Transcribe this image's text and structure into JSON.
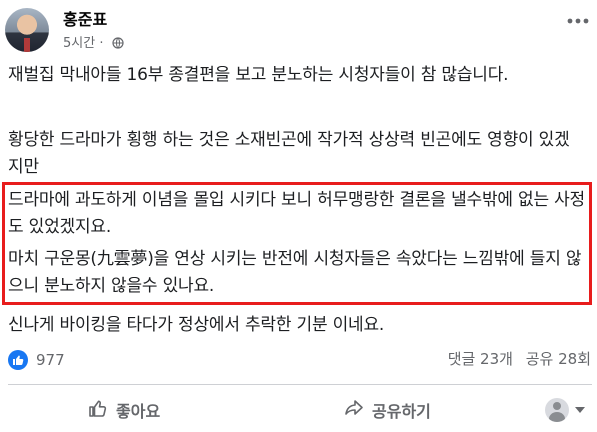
{
  "post": {
    "author": "홍준표",
    "time": "5시간",
    "separator": "·",
    "paragraphs": [
      "재벌집 막내아들 16부 종결편을 보고 분노하는 시청자들이 참 많습니다.",
      "황당한 드라마가 횡행 하는 것은 소재빈곤에 작가적 상상력 빈곤에도 영향이 있겠지만",
      "드라마에 과도하게 이념을 몰입 시키다 보니 허무맹랑한 결론을 낼수밖에 없는 사정도 있었겠지요.",
      "마치 구운몽(九雲夢)을 연상 시키는 반전에 시청자들은 속았다는 느낌밖에 들지 않으니 분노하지 않을수 있나요.",
      "신나게 바이킹을 타다가 정상에서 추락한 기분 이네요."
    ]
  },
  "engagement": {
    "reaction_count": "977",
    "comments": "댓글 23개",
    "shares": "공유 28회"
  },
  "actions": {
    "like_label": "좋아요",
    "share_label": "공유하기"
  },
  "colors": {
    "highlight_border": "#e81c1c",
    "like_blue": "#1877f2",
    "meta_gray": "#65676b"
  },
  "icons": [
    "globe-icon",
    "more-icon",
    "like-reaction-icon",
    "thumbs-up-icon",
    "share-arrow-icon",
    "viewer-avatar",
    "chevron-down-icon"
  ]
}
